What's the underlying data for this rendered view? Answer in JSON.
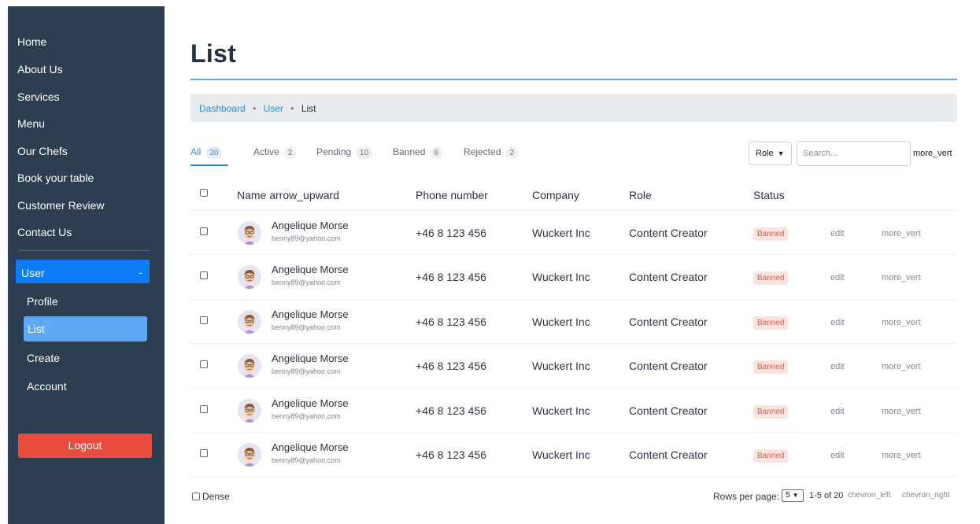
{
  "sidebar": {
    "nav": [
      {
        "label": "Home"
      },
      {
        "label": "About Us"
      },
      {
        "label": "Services"
      },
      {
        "label": "Menu"
      },
      {
        "label": "Our Chefs"
      },
      {
        "label": "Book your table"
      },
      {
        "label": "Customer Review"
      },
      {
        "label": "Contact Us"
      }
    ],
    "user_group": {
      "label": "User",
      "toggle": "-"
    },
    "user_items": [
      {
        "label": "Profile"
      },
      {
        "label": "List"
      },
      {
        "label": "Create"
      },
      {
        "label": "Account"
      }
    ],
    "logout_label": "Logout"
  },
  "page": {
    "title": "List"
  },
  "breadcrumb": {
    "items": [
      "Dashboard",
      "User",
      "List"
    ],
    "separator": "•"
  },
  "tabs": [
    {
      "label": "All",
      "count": "20",
      "active": true
    },
    {
      "label": "Active",
      "count": "2"
    },
    {
      "label": "Pending",
      "count": "10"
    },
    {
      "label": "Banned",
      "count": "6"
    },
    {
      "label": "Rejected",
      "count": "2"
    }
  ],
  "filters": {
    "role_select": "Role",
    "search_placeholder": "Search...",
    "more_icon": "more_vert"
  },
  "table": {
    "headers": {
      "name": "Name arrow_upward",
      "phone": "Phone number",
      "company": "Company",
      "role": "Role",
      "status": "Status"
    },
    "rows": [
      {
        "name": "Angelique Morse",
        "email": "benny89@yahoo.com",
        "phone": "+46 8 123 456",
        "company": "Wuckert Inc",
        "role": "Content Creator",
        "status": "Banned",
        "edit": "edit",
        "more": "more_vert"
      },
      {
        "name": "Angelique Morse",
        "email": "benny89@yahoo.com",
        "phone": "+46 8 123 456",
        "company": "Wuckert Inc",
        "role": "Content Creator",
        "status": "Banned",
        "edit": "edit",
        "more": "more_vert"
      },
      {
        "name": "Angelique Morse",
        "email": "benny89@yahoo.com",
        "phone": "+46 8 123 456",
        "company": "Wuckert Inc",
        "role": "Content Creator",
        "status": "Banned",
        "edit": "edit",
        "more": "more_vert"
      },
      {
        "name": "Angelique Morse",
        "email": "benny89@yahoo.com",
        "phone": "+46 8 123 456",
        "company": "Wuckert Inc",
        "role": "Content Creator",
        "status": "Banned",
        "edit": "edit",
        "more": "more_vert"
      },
      {
        "name": "Angelique Morse",
        "email": "benny89@yahoo.com",
        "phone": "+46 8 123 456",
        "company": "Wuckert Inc",
        "role": "Content Creator",
        "status": "Banned",
        "edit": "edit",
        "more": "more_vert"
      },
      {
        "name": "Angelique Morse",
        "email": "benny89@yahoo.com",
        "phone": "+46 8 123 456",
        "company": "Wuckert Inc",
        "role": "Content Creator",
        "status": "Banned",
        "edit": "edit",
        "more": "more_vert"
      }
    ]
  },
  "footer": {
    "dense_label": "Dense",
    "rows_per_page_label": "Rows per page:",
    "rows_per_page_value": "5",
    "range": "1-5 of 20",
    "prev_icon": "chevron_left",
    "next_icon": "chevron_right"
  },
  "colors": {
    "sidebar_bg": "#2c3e50",
    "accent": "#0d7df7",
    "active_item": "#5fa8f6",
    "logout": "#e74c3c",
    "banned_text": "#e25b4c",
    "banned_bg": "#fbe3df",
    "link": "#2b8fd8"
  }
}
